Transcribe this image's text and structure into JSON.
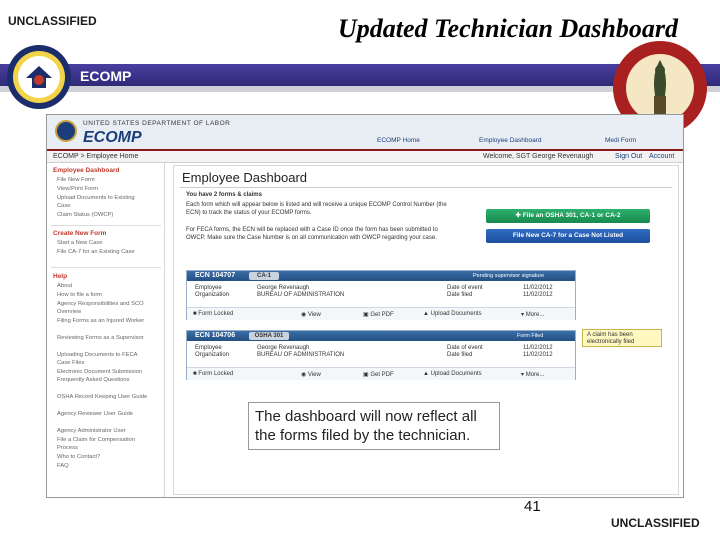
{
  "slide": {
    "classification_top": "UNCLASSIFIED",
    "classification_bottom": "UNCLASSIFIED",
    "title": "Updated Technician Dashboard",
    "callout": "The dashboard will now reflect all the forms filed by the technician.",
    "page_number": "41",
    "left_logo_text": "ECOMP",
    "brand_purple": "#3a3390"
  },
  "app": {
    "agency": "UNITED STATES DEPARTMENT OF LABOR",
    "logo": "ECOMP",
    "top_nav": [
      "ECOMP Home",
      "Employee Dashboard",
      "Medi Form"
    ],
    "breadcrumb": "ECOMP > Employee Home",
    "user_welcome": "Welcome, SGT George Revenaugh",
    "user_links": [
      "Sign Out",
      "Account"
    ],
    "sidebar": {
      "sections": [
        {
          "heading": "Employee Dashboard",
          "items": [
            "File New Form",
            "View/Print Form",
            "Upload Documents to Existing Case",
            "Claim Status (OWCP)"
          ]
        },
        {
          "heading": "Create New Form",
          "items": [
            "Start a New Case",
            "File CA-7 for an Existing Case"
          ]
        },
        {
          "heading": "Help",
          "items": [
            "About",
            "How to file a form",
            "Agency Responsibilities and SCO Overview",
            "Filing Forms as an Injured Worker",
            "Reviewing Forms as a Supervisor",
            "Uploading Documents to FECA Case Files",
            "Electronic Document Submission Frequently Asked Questions",
            "OSHA Record Keeping User Guide",
            "Agency Reviewer User Guide",
            "Agency Administrator User",
            "File a Claim for Compensation Process",
            "Who to Contact?",
            "FAQ"
          ]
        }
      ]
    },
    "dashboard": {
      "title": "Employee Dashboard",
      "summary": "You have 2 forms & claims",
      "para1": "Each form which will appear below is listed and will receive a unique ECOMP Control Number (the ECN) to track the status of your ECOMP forms.",
      "para2": "For FECA forms, the ECN will be replaced with a Case ID once the form has been submitted to OWCP. Make sure the Case Number is on all communication with OWCP regarding your case.",
      "btn_file_new": "File an OSHA 301, CA-1 or CA-2",
      "btn_file_ca7": "File New CA-7 for a Case Not Listed",
      "note_text": "A claim has been electronically filed",
      "cards": [
        {
          "ecn": "ECN 104707",
          "tag": "CA-1",
          "status": "Pending supervisor signature",
          "employee_label": "Employee",
          "employee": "George Revenaugh",
          "org_label": "Organization",
          "org": "BUREAU OF ADMINISTRATION",
          "date_label": "Date of event",
          "date": "11/02/2012",
          "filed_label": "Date filed",
          "filed": "11/02/2012",
          "actions": [
            "Form Locked",
            "View",
            "Get PDF",
            "Upload Documents",
            "More..."
          ]
        },
        {
          "ecn": "ECN 104706",
          "tag": "OSHA 301",
          "status": "Form Filed",
          "employee_label": "Employee",
          "employee": "George Revenaugh",
          "org_label": "Organization",
          "org": "BUREAU OF ADMINISTRATION",
          "date_label": "Date of event",
          "date": "11/02/2012",
          "filed_label": "Date filed",
          "filed": "11/02/2012",
          "actions": [
            "Form Locked",
            "View",
            "Get PDF",
            "Upload Documents",
            "More..."
          ]
        }
      ]
    }
  }
}
